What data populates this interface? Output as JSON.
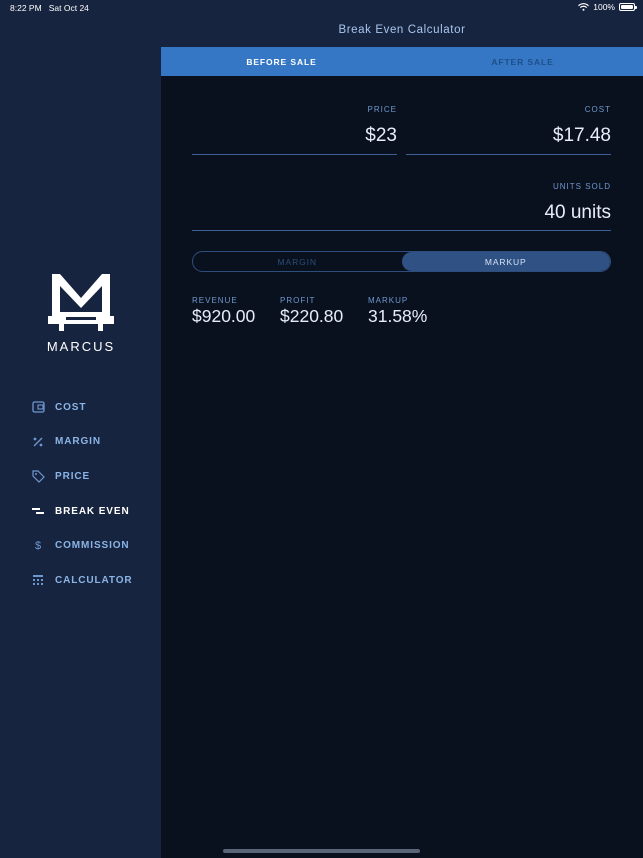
{
  "status_bar": {
    "time": "8:22 PM",
    "date": "Sat Oct 24",
    "battery": "100%"
  },
  "header": {
    "title": "Break Even Calculator"
  },
  "tabs": [
    {
      "label": "BEFORE SALE",
      "active": true
    },
    {
      "label": "AFTER SALE",
      "active": false
    }
  ],
  "fields": {
    "price": {
      "label": "PRICE",
      "value": "$23"
    },
    "cost": {
      "label": "COST",
      "value": "$17.48"
    },
    "units_sold": {
      "label": "UNITS SOLD",
      "value": "40 units"
    }
  },
  "mode_toggle": {
    "options": [
      "MARGIN",
      "MARKUP"
    ],
    "selected": "MARKUP"
  },
  "results": [
    {
      "label": "REVENUE",
      "value": "$920.00"
    },
    {
      "label": "PROFIT",
      "value": "$220.80"
    },
    {
      "label": "MARKUP",
      "value": "31.58%"
    }
  ],
  "brand": {
    "name": "MARCUS"
  },
  "nav": [
    {
      "label": "COST",
      "icon": "wallet-icon",
      "active": false
    },
    {
      "label": "MARGIN",
      "icon": "percent-icon",
      "active": false
    },
    {
      "label": "PRICE",
      "icon": "tag-icon",
      "active": false
    },
    {
      "label": "BREAK EVEN",
      "icon": "break-even-icon",
      "active": true
    },
    {
      "label": "COMMISSION",
      "icon": "dollar-icon",
      "active": false
    },
    {
      "label": "CALCULATOR",
      "icon": "calculator-icon",
      "active": false
    }
  ],
  "colors": {
    "sidebar_bg": "#17243f",
    "main_bg": "#0a111e",
    "tab_bar": "#3577c4",
    "accent_label": "#6f97cf",
    "nav_label": "#8ab4e6",
    "toggle_active": "#2f5184"
  }
}
